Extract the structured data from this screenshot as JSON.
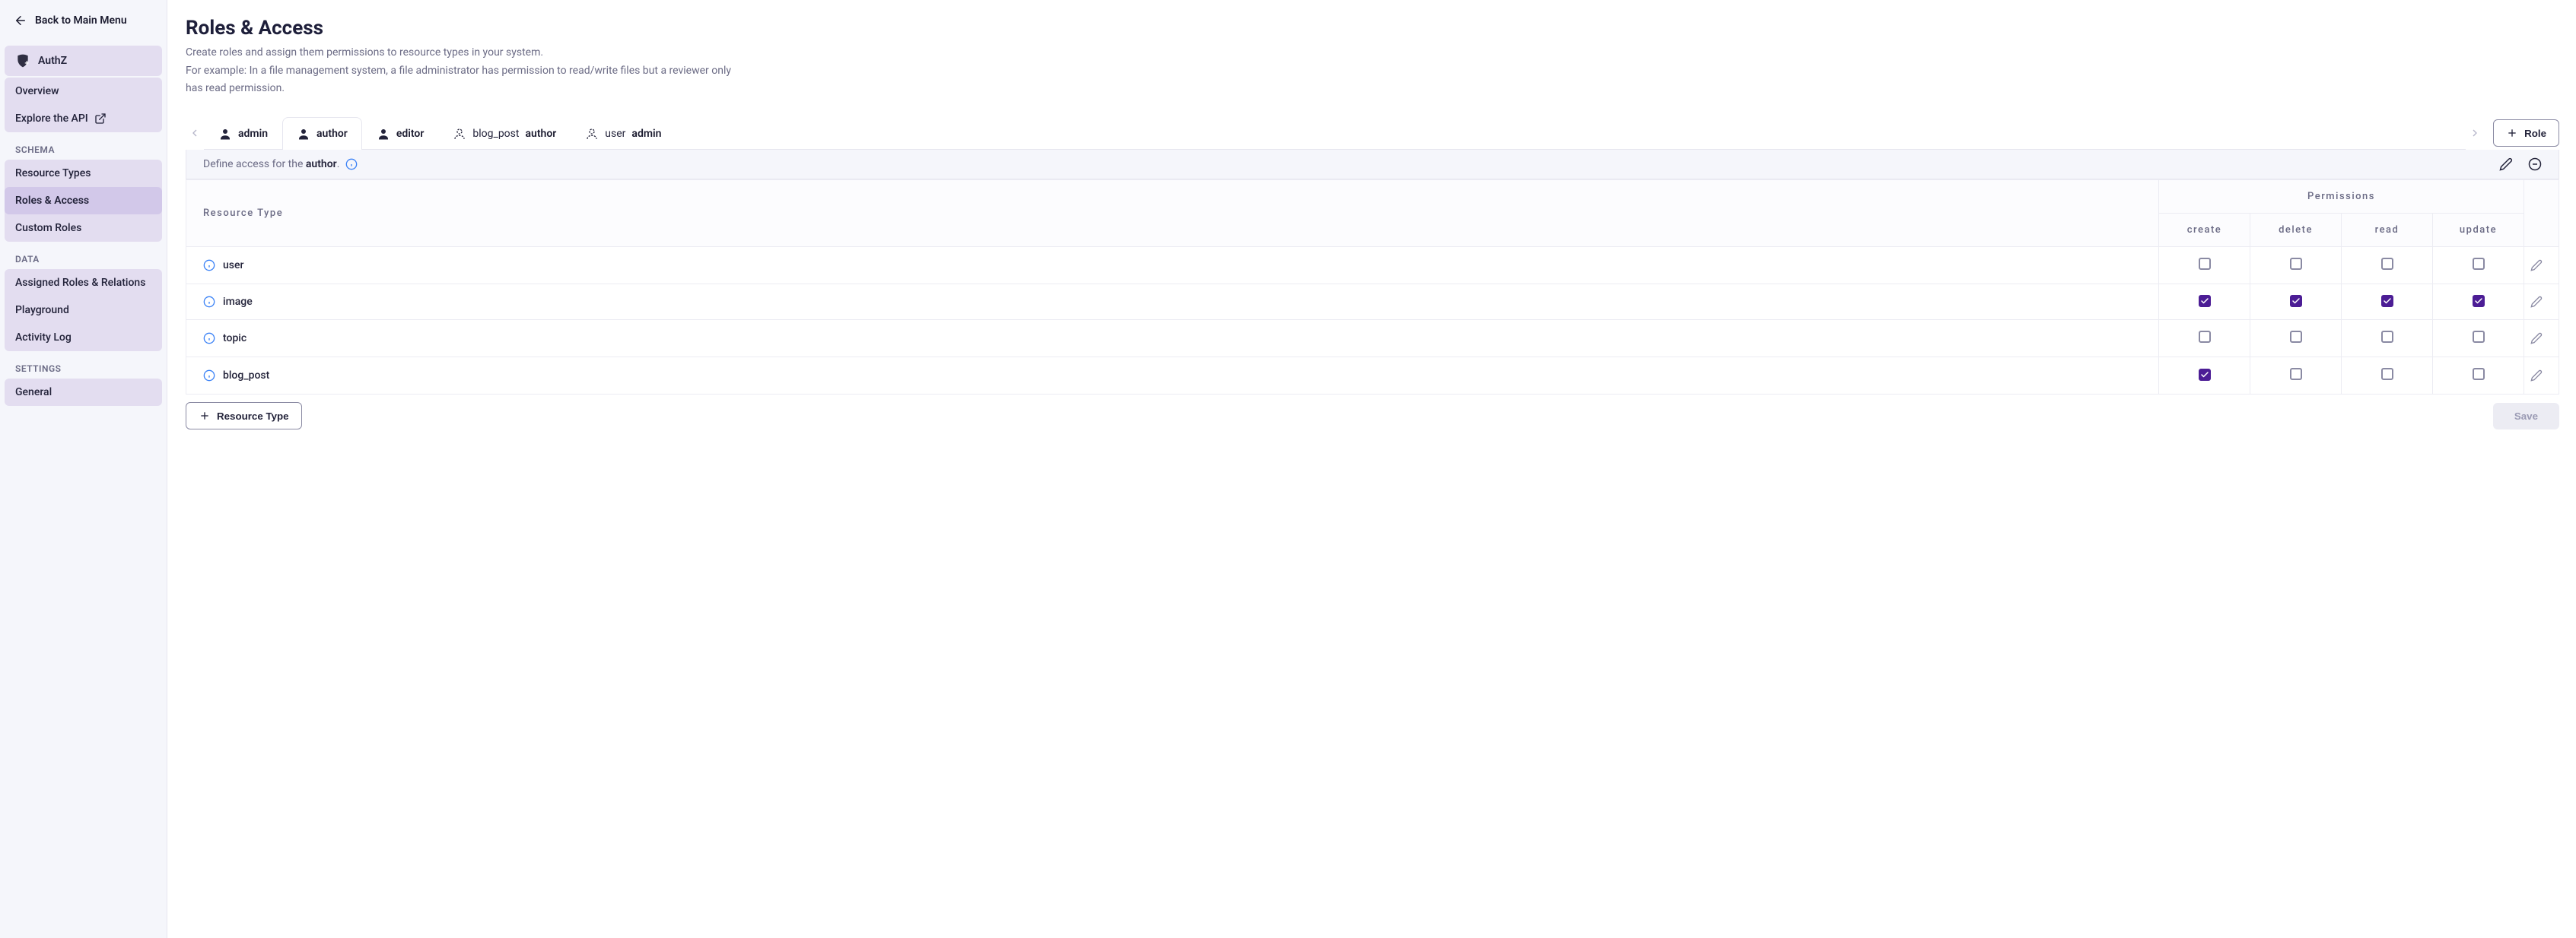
{
  "sidebar": {
    "back_label": "Back to Main Menu",
    "authz_label": "AuthZ",
    "items_top": [
      {
        "label": "Overview"
      },
      {
        "label": "Explore the API",
        "external": true
      }
    ],
    "section_schema": "SCHEMA",
    "items_schema": [
      {
        "label": "Resource Types"
      },
      {
        "label": "Roles & Access",
        "selected": true
      },
      {
        "label": "Custom Roles"
      }
    ],
    "section_data": "DATA",
    "items_data": [
      {
        "label": "Assigned Roles & Relations"
      },
      {
        "label": "Playground"
      },
      {
        "label": "Activity Log"
      }
    ],
    "section_settings": "SETTINGS",
    "items_settings": [
      {
        "label": "General"
      }
    ]
  },
  "header": {
    "title": "Roles & Access",
    "desc1": "Create roles and assign them permissions to resource types in your system.",
    "desc2": "For example: In a file management system, a file administrator has permission to read/write files but a reviewer only has read permission."
  },
  "tabs": [
    {
      "icon": "person",
      "label": "admin"
    },
    {
      "icon": "person",
      "label": "author",
      "active": true
    },
    {
      "icon": "person",
      "label": "editor"
    },
    {
      "icon": "person-dashed",
      "prefix": "blog_post",
      "label": "author"
    },
    {
      "icon": "person-dashed",
      "prefix": "user",
      "label": "admin"
    }
  ],
  "role_button": "Role",
  "panel_header": {
    "prefix": "Define access for the ",
    "role": "author",
    "suffix": "."
  },
  "table": {
    "resource_header": "Resource Type",
    "permissions_header": "Permissions",
    "perm_cols": [
      "create",
      "delete",
      "read",
      "update"
    ],
    "rows": [
      {
        "name": "user",
        "perms": [
          false,
          false,
          false,
          false
        ]
      },
      {
        "name": "image",
        "perms": [
          true,
          true,
          true,
          true
        ]
      },
      {
        "name": "topic",
        "perms": [
          false,
          false,
          false,
          false
        ]
      },
      {
        "name": "blog_post",
        "perms": [
          true,
          false,
          false,
          false
        ]
      }
    ]
  },
  "footer": {
    "resource_type_btn": "Resource Type",
    "save_btn": "Save"
  }
}
